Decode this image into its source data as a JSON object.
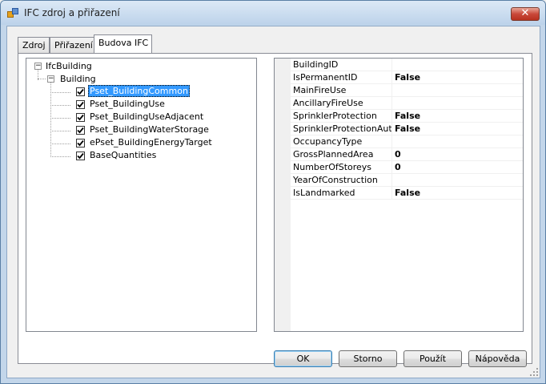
{
  "window": {
    "title": "IFC zdroj a přiřazení",
    "close_glyph": "✕"
  },
  "tabs": [
    {
      "label": "Zdroj"
    },
    {
      "label": "Přiřazení"
    },
    {
      "label": "Budova IFC",
      "active": true
    }
  ],
  "tree": {
    "root": {
      "label": "IfcBuilding",
      "expander": "−"
    },
    "child": {
      "label": "Building",
      "expander": "−"
    },
    "items": [
      {
        "label": "Pset_BuildingCommon",
        "checked": true,
        "selected": true
      },
      {
        "label": "Pset_BuildingUse",
        "checked": true
      },
      {
        "label": "Pset_BuildingUseAdjacent",
        "checked": true
      },
      {
        "label": "Pset_BuildingWaterStorage",
        "checked": true
      },
      {
        "label": "ePset_BuildingEnergyTarget",
        "checked": true
      },
      {
        "label": "BaseQuantities",
        "checked": true
      }
    ]
  },
  "properties": [
    {
      "name": "BuildingID",
      "value": ""
    },
    {
      "name": "IsPermanentID",
      "value": "False"
    },
    {
      "name": "MainFireUse",
      "value": ""
    },
    {
      "name": "AncillaryFireUse",
      "value": ""
    },
    {
      "name": "SprinklerProtection",
      "value": "False"
    },
    {
      "name": "SprinklerProtectionAutomatic",
      "value": "False"
    },
    {
      "name": "OccupancyType",
      "value": ""
    },
    {
      "name": "GrossPlannedArea",
      "value": "0"
    },
    {
      "name": "NumberOfStoreys",
      "value": "0"
    },
    {
      "name": "YearOfConstruction",
      "value": ""
    },
    {
      "name": "IsLandmarked",
      "value": "False"
    }
  ],
  "buttons": {
    "ok": "OK",
    "cancel": "Storno",
    "apply": "Použít",
    "help": "Nápověda"
  }
}
